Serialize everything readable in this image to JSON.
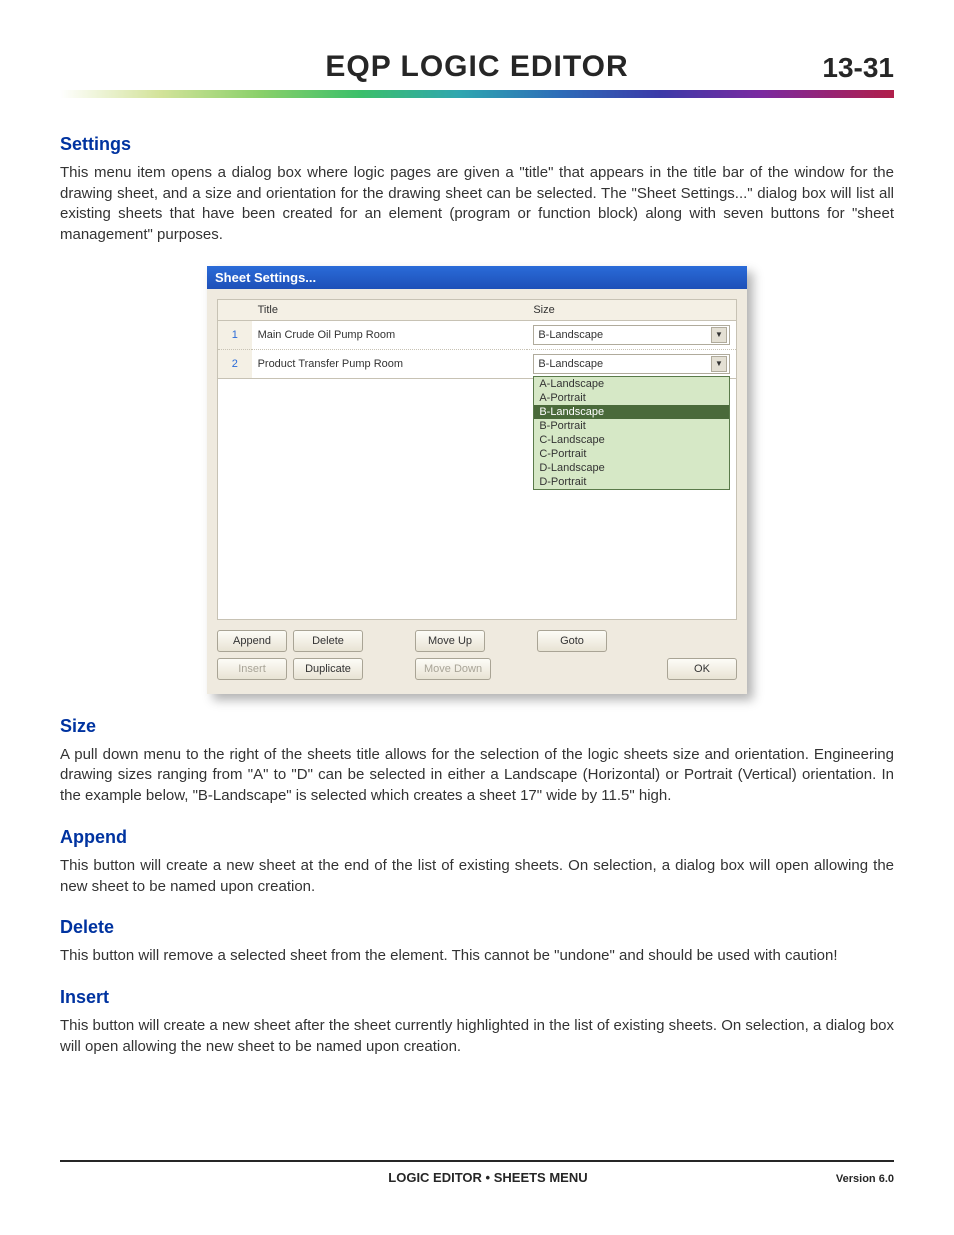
{
  "header": {
    "title": "EQP LOGIC EDITOR",
    "page_number": "13-31"
  },
  "sections": {
    "settings": {
      "heading": "Settings",
      "text": "This menu item opens a dialog box where logic pages are given a \"title\" that appears in the title bar of the window for the drawing sheet, and a size and orientation for the drawing sheet can be selected.  The \"Sheet Settings...\" dialog box will list all existing sheets that have been created for an element (program or function block) along with seven buttons for \"sheet management\" purposes."
    },
    "size": {
      "heading": "Size",
      "text": "A pull down menu to the right of the sheets title allows for the selection of the logic sheets size and orientation.  Engineering drawing sizes ranging from \"A\" to \"D\" can be selected in either a Landscape (Horizontal) or Portrait (Vertical) orientation.  In the example below, \"B-Landscape\" is selected which creates a sheet 17\" wide by 11.5\" high."
    },
    "append": {
      "heading": "Append",
      "text": "This button will create a new sheet at the end of the list of existing sheets.  On selection, a dialog box will open allowing the new sheet to be named upon creation."
    },
    "delete": {
      "heading": "Delete",
      "text": "This button will remove a selected sheet from the element.  This cannot be \"undone\" and should be used with caution!"
    },
    "insert": {
      "heading": "Insert",
      "text": "This button will create a new sheet after the sheet currently highlighted in the list of existing sheets.  On selection, a dialog box will open allowing the new sheet to be named upon creation."
    }
  },
  "dialog": {
    "title": "Sheet Settings...",
    "columns": {
      "title": "Title",
      "size": "Size"
    },
    "rows": [
      {
        "num": "1",
        "title": "Main Crude Oil Pump Room",
        "size": "B-Landscape"
      },
      {
        "num": "2",
        "title": "Product Transfer Pump Room",
        "size": "B-Landscape"
      }
    ],
    "size_options": [
      "A-Landscape",
      "A-Portrait",
      "B-Landscape",
      "B-Portrait",
      "C-Landscape",
      "C-Portrait",
      "D-Landscape",
      "D-Portrait"
    ],
    "buttons": {
      "append": "Append",
      "delete": "Delete",
      "move_up": "Move Up",
      "goto": "Goto",
      "insert": "Insert",
      "duplicate": "Duplicate",
      "move_down": "Move Down",
      "ok": "OK"
    }
  },
  "footer": {
    "center": "LOGIC EDITOR • SHEETS MENU",
    "right": "Version 6.0"
  }
}
